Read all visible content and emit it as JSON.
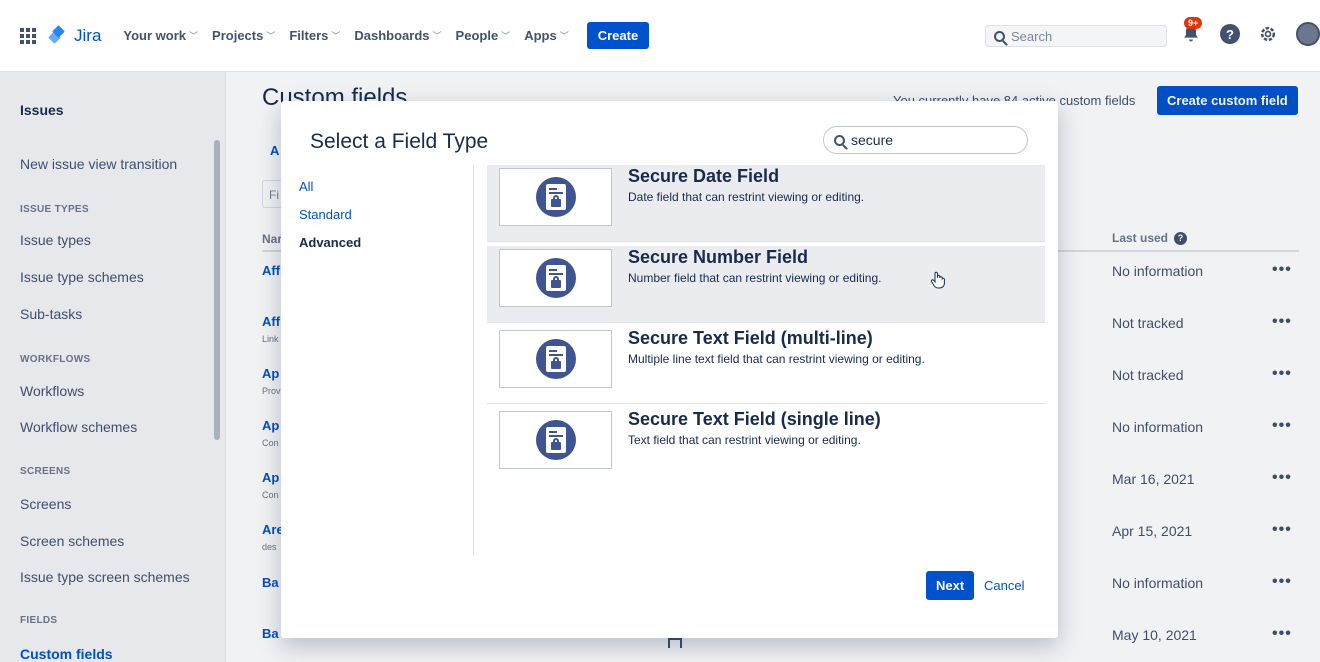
{
  "topnav": {
    "app_name": "Jira",
    "items": [
      {
        "label": "Your work"
      },
      {
        "label": "Projects"
      },
      {
        "label": "Filters"
      },
      {
        "label": "Dashboards"
      },
      {
        "label": "People"
      },
      {
        "label": "Apps"
      }
    ],
    "create_label": "Create",
    "search_placeholder": "Search",
    "notifications_badge": "9+",
    "help_glyph": "?"
  },
  "sidebar": {
    "title": "Issues",
    "items": [
      {
        "label": "New issue view transition",
        "type": "item"
      },
      {
        "label": "ISSUE TYPES",
        "type": "heading"
      },
      {
        "label": "Issue types",
        "type": "item"
      },
      {
        "label": "Issue type schemes",
        "type": "item"
      },
      {
        "label": "Sub-tasks",
        "type": "item"
      },
      {
        "label": "WORKFLOWS",
        "type": "heading"
      },
      {
        "label": "Workflows",
        "type": "item"
      },
      {
        "label": "Workflow schemes",
        "type": "item"
      },
      {
        "label": "SCREENS",
        "type": "heading"
      },
      {
        "label": "Screens",
        "type": "item"
      },
      {
        "label": "Screen schemes",
        "type": "item"
      },
      {
        "label": "Issue type screen schemes",
        "type": "item"
      },
      {
        "label": "FIELDS",
        "type": "heading"
      },
      {
        "label": "Custom fields",
        "type": "active"
      }
    ]
  },
  "page": {
    "title": "Custom fields",
    "active_count_text": "You currently have 84 active custom fields",
    "create_button": "Create custom field",
    "tab_fragment": "A",
    "filter_fragment": "Fi",
    "col_name": "Nar",
    "col_last_used": "Last used",
    "rows": [
      {
        "name": "Aff",
        "sub": "",
        "last_used": "No information"
      },
      {
        "name": "Aff",
        "sub": "Link",
        "last_used": "Not tracked"
      },
      {
        "name": "Ap",
        "sub": "Prov",
        "last_used": "Not tracked"
      },
      {
        "name": "Ap",
        "sub": "Con",
        "last_used": "No information"
      },
      {
        "name": "Ap",
        "sub": "Con",
        "last_used": "Mar 16, 2021"
      },
      {
        "name": "Are",
        "sub": "des",
        "last_used": "Apr 15, 2021"
      },
      {
        "name": "Ba",
        "sub": "",
        "last_used": "No information"
      },
      {
        "name": "Ba",
        "sub": "",
        "last_used": "May 10, 2021"
      }
    ],
    "more_glyph": "•••"
  },
  "modal": {
    "title": "Select a Field Type",
    "search_value": "secure",
    "categories": [
      {
        "label": "All",
        "selected": false
      },
      {
        "label": "Standard",
        "selected": false
      },
      {
        "label": "Advanced",
        "selected": true
      }
    ],
    "field_types": [
      {
        "name": "Secure Date Field",
        "description": "Date field that can restrint viewing or editing.",
        "highlighted": true
      },
      {
        "name": "Secure Number Field",
        "description": "Number field that can restrint viewing or editing.",
        "highlighted": true
      },
      {
        "name": "Secure Text Field (multi-line)",
        "description": "Multiple line text field that can restrint viewing or editing.",
        "highlighted": false
      },
      {
        "name": "Secure Text Field (single line)",
        "description": "Text field that can restrint viewing or editing.",
        "highlighted": false
      }
    ],
    "next_label": "Next",
    "cancel_label": "Cancel"
  },
  "icons": [
    "app-switcher-icon",
    "jira-logo-icon",
    "chevron-down-icon",
    "search-icon",
    "notification-icon",
    "help-icon",
    "settings-icon",
    "avatar",
    "secure-field-icon",
    "hand-cursor-icon"
  ],
  "colors": {
    "brand": "#0052cc",
    "icon_fill": "#3f5491",
    "highlight": "#ebecf0"
  }
}
